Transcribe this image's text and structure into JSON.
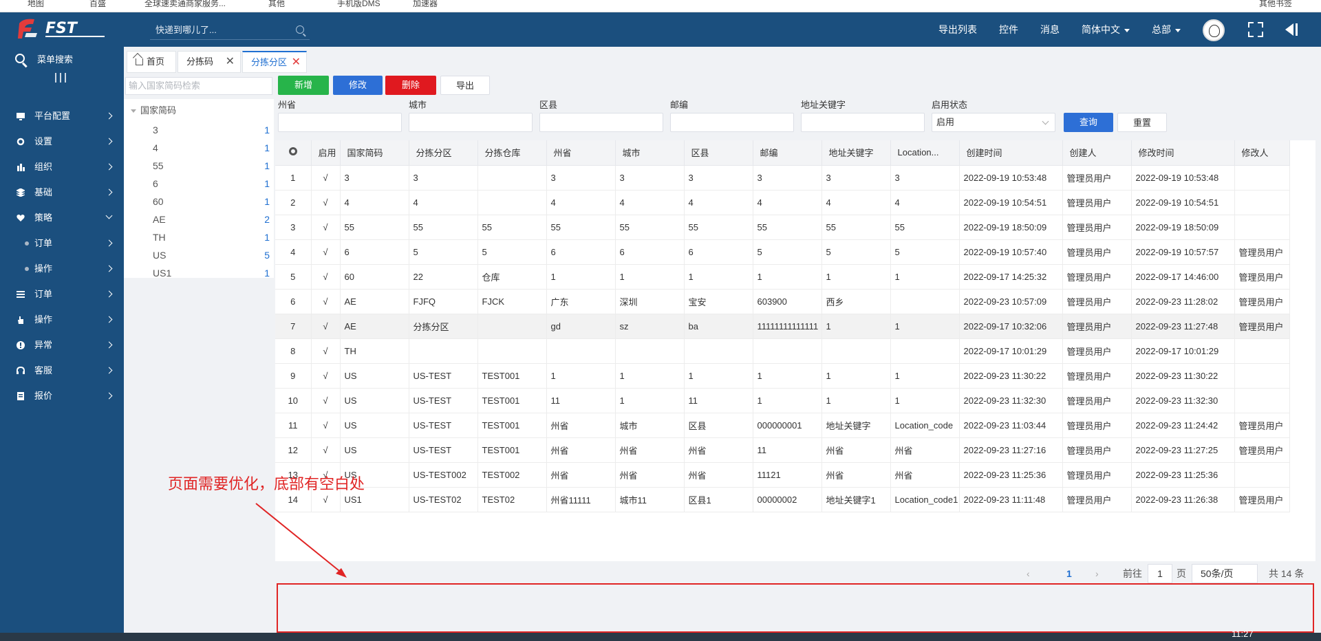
{
  "bookmarks": [
    "地图",
    "百盛",
    "全球速卖通商家服务...",
    "其他",
    "手机版DMS",
    "加速器",
    "其他书签"
  ],
  "header": {
    "quick_search_placeholder": "快递到哪儿了...",
    "nav": [
      "导出列表",
      "控件",
      "消息",
      "简体中文",
      "总部"
    ]
  },
  "sidebar": {
    "search_label": "菜单搜索",
    "items": [
      {
        "label": "平台配置",
        "icon": "monitor-icon",
        "expanded": false
      },
      {
        "label": "设置",
        "icon": "gear-icon",
        "expanded": false
      },
      {
        "label": "组织",
        "icon": "org-icon",
        "expanded": false
      },
      {
        "label": "基础",
        "icon": "layers-icon",
        "expanded": false
      },
      {
        "label": "策略",
        "icon": "heart-icon",
        "expanded": true
      },
      {
        "label": "订单",
        "icon": "dot",
        "sub": true
      },
      {
        "label": "操作",
        "icon": "dot",
        "sub": true
      },
      {
        "label": "订单",
        "icon": "list-icon",
        "expanded": false
      },
      {
        "label": "操作",
        "icon": "hand-icon",
        "expanded": false
      },
      {
        "label": "异常",
        "icon": "alert-icon",
        "expanded": false
      },
      {
        "label": "客服",
        "icon": "headset-icon",
        "expanded": false
      },
      {
        "label": "报价",
        "icon": "report-icon",
        "expanded": false
      }
    ]
  },
  "tabs": [
    {
      "label": "首页",
      "closable": false,
      "active": false
    },
    {
      "label": "分拣码",
      "closable": true,
      "active": false
    },
    {
      "label": "分拣分区",
      "closable": true,
      "active": true
    }
  ],
  "tree": {
    "search_placeholder": "输入国家简码检索",
    "root": "国家简码",
    "nodes": [
      {
        "label": "3",
        "count": "1"
      },
      {
        "label": "4",
        "count": "1"
      },
      {
        "label": "55",
        "count": "1"
      },
      {
        "label": "6",
        "count": "1"
      },
      {
        "label": "60",
        "count": "1"
      },
      {
        "label": "AE",
        "count": "2"
      },
      {
        "label": "TH",
        "count": "1"
      },
      {
        "label": "US",
        "count": "5"
      },
      {
        "label": "US1",
        "count": "1"
      }
    ]
  },
  "toolbar": {
    "add": "新增",
    "edit": "修改",
    "delete": "删除",
    "export": "导出",
    "colors": {
      "add": "#27b44a",
      "edit": "#2d6fd6",
      "delete": "#e0191f"
    }
  },
  "filters": {
    "state": "州省",
    "city": "城市",
    "district": "区县",
    "zip": "邮编",
    "keyword": "地址关键字",
    "status": "启用状态",
    "status_value": "启用",
    "query": "查询",
    "reset": "重置"
  },
  "table": {
    "headers": [
      "启用",
      "国家简码",
      "分拣分区",
      "分拣仓库",
      "州省",
      "城市",
      "区县",
      "邮编",
      "地址关键字",
      "Location...",
      "创建时间",
      "创建人",
      "修改时间",
      "修改人"
    ],
    "rows": [
      [
        "1",
        "√",
        "3",
        "3",
        "",
        "3",
        "3",
        "3",
        "3",
        "3",
        "3",
        "2022-09-19 10:53:48",
        "管理员用户",
        "2022-09-19 10:53:48",
        ""
      ],
      [
        "2",
        "√",
        "4",
        "4",
        "",
        "4",
        "4",
        "4",
        "4",
        "4",
        "4",
        "2022-09-19 10:54:51",
        "管理员用户",
        "2022-09-19 10:54:51",
        ""
      ],
      [
        "3",
        "√",
        "55",
        "55",
        "55",
        "55",
        "55",
        "55",
        "55",
        "55",
        "55",
        "2022-09-19 18:50:09",
        "管理员用户",
        "2022-09-19 18:50:09",
        ""
      ],
      [
        "4",
        "√",
        "6",
        "5",
        "5",
        "6",
        "6",
        "6",
        "5",
        "5",
        "5",
        "2022-09-19 10:57:40",
        "管理员用户",
        "2022-09-19 10:57:57",
        "管理员用户"
      ],
      [
        "5",
        "√",
        "60",
        "22",
        "仓库",
        "1",
        "1",
        "1",
        "1",
        "1",
        "1",
        "2022-09-17 14:25:32",
        "管理员用户",
        "2022-09-17 14:46:00",
        "管理员用户"
      ],
      [
        "6",
        "√",
        "AE",
        "FJFQ",
        "FJCK",
        "广东",
        "深圳",
        "宝安",
        "603900",
        "西乡",
        "",
        "2022-09-23 10:57:09",
        "管理员用户",
        "2022-09-23 11:28:02",
        "管理员用户"
      ],
      [
        "7",
        "√",
        "AE",
        "分拣分区",
        "",
        "gd",
        "sz",
        "ba",
        "11111111111111",
        "1",
        "1",
        "2022-09-17 10:32:06",
        "管理员用户",
        "2022-09-23 11:27:48",
        "管理员用户"
      ],
      [
        "8",
        "√",
        "TH",
        "",
        "",
        "",
        "",
        "",
        "",
        "",
        "",
        "2022-09-17 10:01:29",
        "管理员用户",
        "2022-09-17 10:01:29",
        ""
      ],
      [
        "9",
        "√",
        "US",
        "US-TEST",
        "TEST001",
        "1",
        "1",
        "1",
        "1",
        "1",
        "1",
        "2022-09-23 11:30:22",
        "管理员用户",
        "2022-09-23 11:30:22",
        ""
      ],
      [
        "10",
        "√",
        "US",
        "US-TEST",
        "TEST001",
        "11",
        "1",
        "11",
        "1",
        "1",
        "1",
        "2022-09-23 11:32:30",
        "管理员用户",
        "2022-09-23 11:32:30",
        ""
      ],
      [
        "11",
        "√",
        "US",
        "US-TEST",
        "TEST001",
        "州省",
        "城市",
        "区县",
        "000000001",
        "地址关键字",
        "Location_code",
        "2022-09-23 11:03:44",
        "管理员用户",
        "2022-09-23 11:24:42",
        "管理员用户"
      ],
      [
        "12",
        "√",
        "US",
        "US-TEST",
        "TEST001",
        "州省",
        "州省",
        "州省",
        "11",
        "州省",
        "州省",
        "2022-09-23 11:27:16",
        "管理员用户",
        "2022-09-23 11:27:25",
        "管理员用户"
      ],
      [
        "13",
        "√",
        "US",
        "US-TEST002",
        "TEST002",
        "州省",
        "州省",
        "州省",
        "11121",
        "州省",
        "州省",
        "2022-09-23 11:25:36",
        "管理员用户",
        "2022-09-23 11:25:36",
        ""
      ],
      [
        "14",
        "√",
        "US1",
        "US-TEST02",
        "TEST02",
        "州省11111",
        "城市11",
        "区县1",
        "00000002",
        "地址关键字1",
        "Location_code1",
        "2022-09-23 11:11:48",
        "管理员用户",
        "2022-09-23 11:26:38",
        "管理员用户"
      ]
    ]
  },
  "pagination": {
    "current": "1",
    "goto_prefix": "前往",
    "goto_value": "1",
    "goto_suffix": "页",
    "page_size": "50条/页",
    "total": "共 14 条"
  },
  "annotation": {
    "text": "页面需要优化，底部有空白处",
    "color": "#e02424"
  },
  "taskbar": {
    "time": "11:27"
  }
}
